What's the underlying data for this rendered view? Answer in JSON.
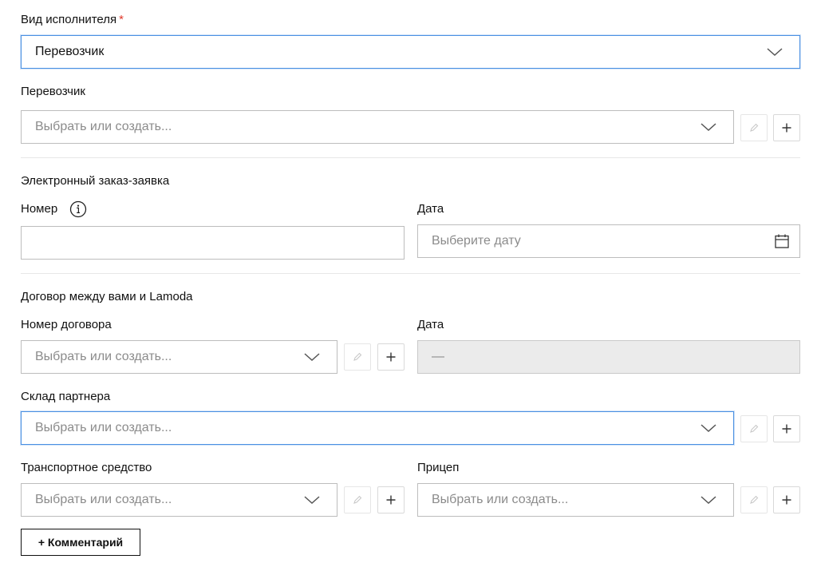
{
  "performer_type": {
    "label": "Вид исполнителя",
    "required_mark": "*",
    "value": "Перевозчик"
  },
  "carrier": {
    "label": "Перевозчик",
    "placeholder": "Выбрать или создать..."
  },
  "e_order": {
    "section_title": "Электронный заказ-заявка",
    "number_label": "Номер",
    "number_value": "",
    "date_label": "Дата",
    "date_placeholder": "Выберите дату"
  },
  "contract": {
    "section_title": "Договор между вами и Lamoda",
    "number_label": "Номер договора",
    "number_placeholder": "Выбрать или создать...",
    "date_label": "Дата",
    "date_value": "—"
  },
  "partner_warehouse": {
    "label": "Склад партнера",
    "placeholder": "Выбрать или создать..."
  },
  "vehicle": {
    "label": "Транспортное средство",
    "placeholder": "Выбрать или создать..."
  },
  "trailer": {
    "label": "Прицеп",
    "placeholder": "Выбрать или создать..."
  },
  "comment_button": {
    "label": "+ Комментарий"
  },
  "icons": {
    "dropdown": "chevron-down-icon",
    "edit": "pencil-icon",
    "add": "plus-icon",
    "calendar": "calendar-icon",
    "info": "info-icon"
  },
  "colors": {
    "focus_border": "#4a90e2",
    "required": "#e0392b",
    "placeholder": "#8b8b8b",
    "disabled_bg": "#ebebeb"
  }
}
